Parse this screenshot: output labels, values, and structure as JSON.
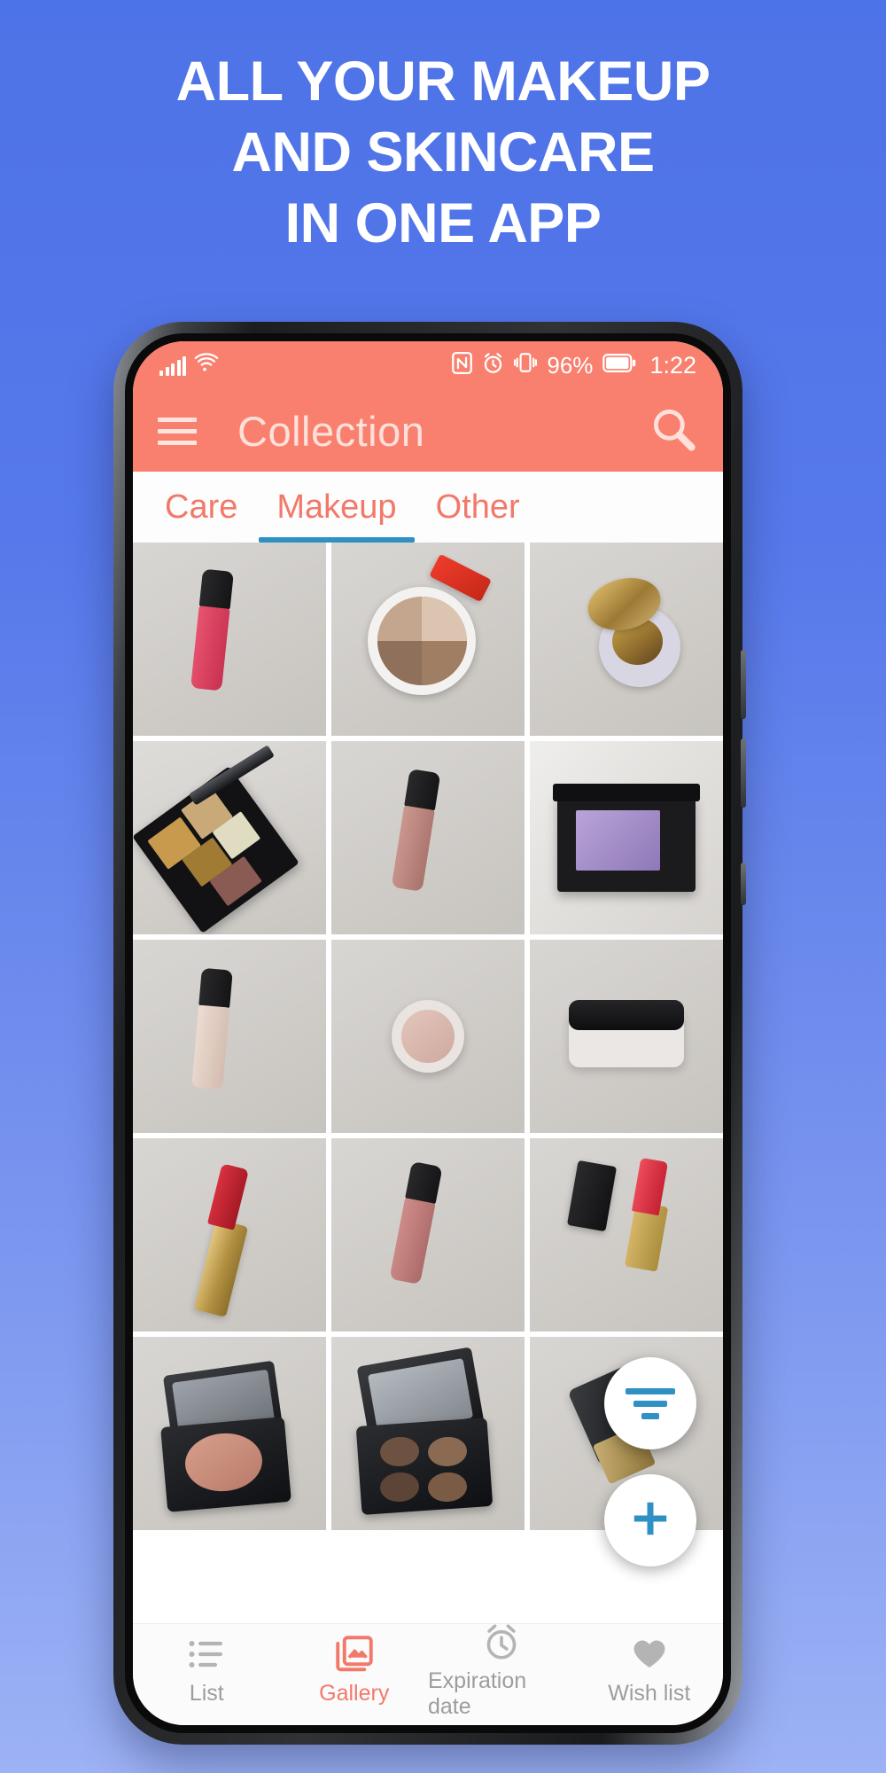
{
  "promo": {
    "line1": "ALL YOUR MAKEUP",
    "line2": "AND SKINCARE",
    "line3": "IN ONE APP",
    "bg_gradient_top": "#4d73e8",
    "bg_gradient_bottom": "#9db2f5",
    "text_color": "#ffffff"
  },
  "statusbar": {
    "signal_icon": "signal-bars-icon",
    "wifi_icon": "wifi-icon",
    "nfc_icon": "nfc-icon",
    "alarm_icon": "alarm-clock-icon",
    "vibrate_icon": "vibrate-icon",
    "battery_percent": "96%",
    "battery_icon": "battery-icon",
    "time": "1:22",
    "background": "#f9806e",
    "foreground": "#ffffff"
  },
  "appbar": {
    "menu_icon": "hamburger-menu-icon",
    "title": "Collection",
    "search_icon": "search-icon",
    "background": "#f9806e",
    "title_color": "#ffe0da"
  },
  "tabs": {
    "accent_color": "#f2796a",
    "indicator_color": "#2f90c4",
    "items": [
      {
        "label": "Care",
        "active": false
      },
      {
        "label": "Makeup",
        "active": true
      },
      {
        "label": "Other",
        "active": false
      }
    ]
  },
  "gallery": {
    "columns": 3,
    "items": [
      {
        "name": "pink-lip-gloss",
        "type": "gloss",
        "bg": "bg-gray",
        "color": "#d94567"
      },
      {
        "name": "bronzer-quad-compact",
        "type": "compact",
        "bg": "bg-gray"
      },
      {
        "name": "gold-open-compact",
        "type": "compact2",
        "bg": "bg-gray"
      },
      {
        "name": "five-color-eyeshadow-palette",
        "type": "palette",
        "bg": "bg-gray2"
      },
      {
        "name": "nude-lip-gloss",
        "type": "gloss",
        "bg": "bg-gray",
        "color": "#bf8b84"
      },
      {
        "name": "purple-eyeshadow-single",
        "type": "single",
        "bg": "bg-marble"
      },
      {
        "name": "beige-lip-gloss",
        "type": "gloss",
        "bg": "bg-gray",
        "color": "#ddc8bd"
      },
      {
        "name": "cream-pot-highlighter",
        "type": "pot",
        "bg": "bg-gray"
      },
      {
        "name": "loose-powder-jar",
        "type": "jar",
        "bg": "bg-gray"
      },
      {
        "name": "red-lipstick-gold-case",
        "type": "lipstick",
        "bg": "bg-gray",
        "color": "#c32636"
      },
      {
        "name": "rose-lip-gloss",
        "type": "gloss",
        "bg": "bg-gray",
        "color": "#c07c7a"
      },
      {
        "name": "red-lipstick-black-case",
        "type": "lipstick2",
        "bg": "bg-gray",
        "color": "#e2485a"
      },
      {
        "name": "blush-compact-mirror",
        "type": "blush",
        "bg": "bg-gray"
      },
      {
        "name": "four-pan-eyeshadow-compact",
        "type": "quad",
        "bg": "bg-gray"
      },
      {
        "name": "black-powder-container",
        "type": "cylinder",
        "bg": "bg-gray"
      }
    ]
  },
  "fabs": {
    "filter": {
      "icon": "filter-icon",
      "color": "#2f90c4"
    },
    "add": {
      "icon": "plus-icon",
      "label": "+",
      "color": "#2f90c4"
    }
  },
  "bottomnav": {
    "active_color": "#f2796a",
    "inactive_color": "#9d9d9d",
    "items": [
      {
        "label": "List",
        "icon": "list-icon",
        "active": false
      },
      {
        "label": "Gallery",
        "icon": "gallery-icon",
        "active": true
      },
      {
        "label": "Expiration date",
        "icon": "alarm-clock-icon",
        "active": false
      },
      {
        "label": "Wish list",
        "icon": "heart-icon",
        "active": false
      }
    ]
  }
}
